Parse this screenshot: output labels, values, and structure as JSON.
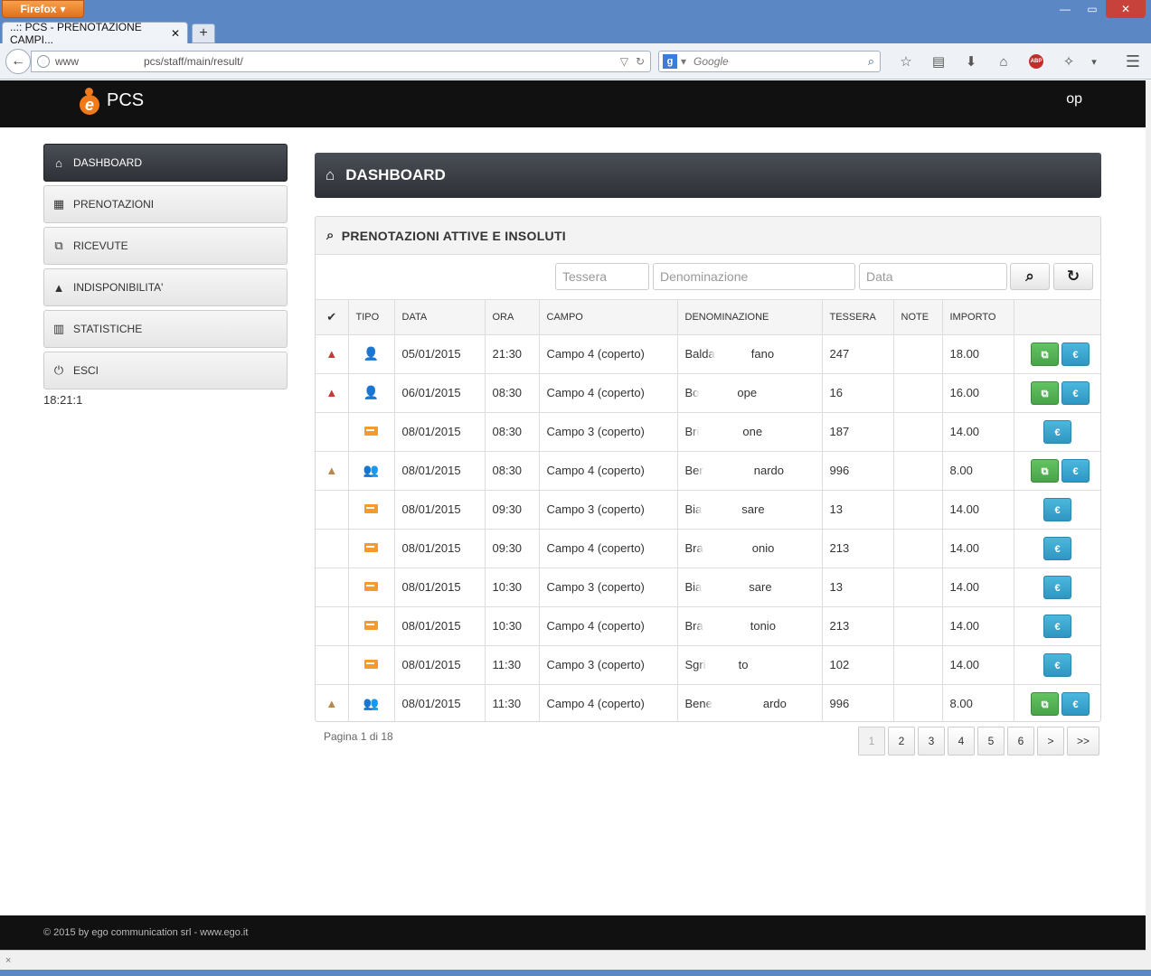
{
  "browser": {
    "app_button": "Firefox",
    "tab_title": "..:: PCS - PRENOTAZIONE CAMPI...",
    "url_prefix": "www",
    "url_path": "pcs/staff/main/result/",
    "search_placeholder": "Google"
  },
  "header": {
    "logo_text": "PCS",
    "user": "op"
  },
  "sidebar": {
    "items": [
      {
        "label": "DASHBOARD",
        "icon": "home-icon",
        "active": true
      },
      {
        "label": "PRENOTAZIONI",
        "icon": "calendar-icon",
        "active": false
      },
      {
        "label": "RICEVUTE",
        "icon": "copy-icon",
        "active": false
      },
      {
        "label": "INDISPONIBILITA'",
        "icon": "warning-icon",
        "active": false
      },
      {
        "label": "STATISTICHE",
        "icon": "bar-chart-icon",
        "active": false
      },
      {
        "label": "ESCI",
        "icon": "power-icon",
        "active": false
      }
    ],
    "clock": "18:21:1"
  },
  "main": {
    "title": "DASHBOARD",
    "panel_title": "PRENOTAZIONI ATTIVE E INSOLUTI",
    "filters": {
      "tessera_placeholder": "Tessera",
      "denominazione_placeholder": "Denominazione",
      "data_placeholder": "Data"
    },
    "columns": [
      "✔",
      "TIPO",
      "DATA",
      "ORA",
      "CAMPO",
      "DENOMINAZIONE",
      "TESSERA",
      "NOTE",
      "IMPORTO",
      ""
    ],
    "rows": [
      {
        "warn": "red",
        "tipo": "person",
        "data": "05/01/2015",
        "ora": "21:30",
        "campo": "Campo 4 (coperto)",
        "den_a": "Balda",
        "den_b": "fano",
        "tessera": "247",
        "note": "",
        "importo": "18.00",
        "receipt": true
      },
      {
        "warn": "red",
        "tipo": "person",
        "data": "06/01/2015",
        "ora": "08:30",
        "campo": "Campo 4 (coperto)",
        "den_a": "Bo",
        "den_b": "ope",
        "tessera": "16",
        "note": "",
        "importo": "16.00",
        "receipt": true
      },
      {
        "warn": "",
        "tipo": "card",
        "data": "08/01/2015",
        "ora": "08:30",
        "campo": "Campo 3 (coperto)",
        "den_a": "Bri",
        "den_b": "one",
        "tessera": "187",
        "note": "",
        "importo": "14.00",
        "receipt": false
      },
      {
        "warn": "amber",
        "tipo": "people",
        "data": "08/01/2015",
        "ora": "08:30",
        "campo": "Campo 4 (coperto)",
        "den_a": "Ber",
        "den_b": "nardo",
        "tessera": "996",
        "note": "",
        "importo": "8.00",
        "receipt": true
      },
      {
        "warn": "",
        "tipo": "card",
        "data": "08/01/2015",
        "ora": "09:30",
        "campo": "Campo 3 (coperto)",
        "den_a": "Bia",
        "den_b": "sare",
        "tessera": "13",
        "note": "",
        "importo": "14.00",
        "receipt": false
      },
      {
        "warn": "",
        "tipo": "card",
        "data": "08/01/2015",
        "ora": "09:30",
        "campo": "Campo 4 (coperto)",
        "den_a": "Bra",
        "den_b": "onio",
        "tessera": "213",
        "note": "",
        "importo": "14.00",
        "receipt": false
      },
      {
        "warn": "",
        "tipo": "card",
        "data": "08/01/2015",
        "ora": "10:30",
        "campo": "Campo 3 (coperto)",
        "den_a": "Bia",
        "den_b": "sare",
        "tessera": "13",
        "note": "",
        "importo": "14.00",
        "receipt": false
      },
      {
        "warn": "",
        "tipo": "card",
        "data": "08/01/2015",
        "ora": "10:30",
        "campo": "Campo 4 (coperto)",
        "den_a": "Bra",
        "den_b": "tonio",
        "tessera": "213",
        "note": "",
        "importo": "14.00",
        "receipt": false
      },
      {
        "warn": "",
        "tipo": "card",
        "data": "08/01/2015",
        "ora": "11:30",
        "campo": "Campo 3 (coperto)",
        "den_a": "Sgri",
        "den_b": "to",
        "tessera": "102",
        "note": "",
        "importo": "14.00",
        "receipt": false
      },
      {
        "warn": "amber",
        "tipo": "people",
        "data": "08/01/2015",
        "ora": "11:30",
        "campo": "Campo 4 (coperto)",
        "den_a": "Bene",
        "den_b": "ardo",
        "tessera": "996",
        "note": "",
        "importo": "8.00",
        "receipt": true
      }
    ],
    "pay_label": "€",
    "page_info": "Pagina 1 di 18",
    "pages": [
      "1",
      "2",
      "3",
      "4",
      "5",
      "6",
      ">",
      ">>"
    ]
  },
  "footer": {
    "text": "© 2015 by ego communication srl - www.ego.it"
  },
  "statusbar": {
    "close_glyph": "×"
  }
}
